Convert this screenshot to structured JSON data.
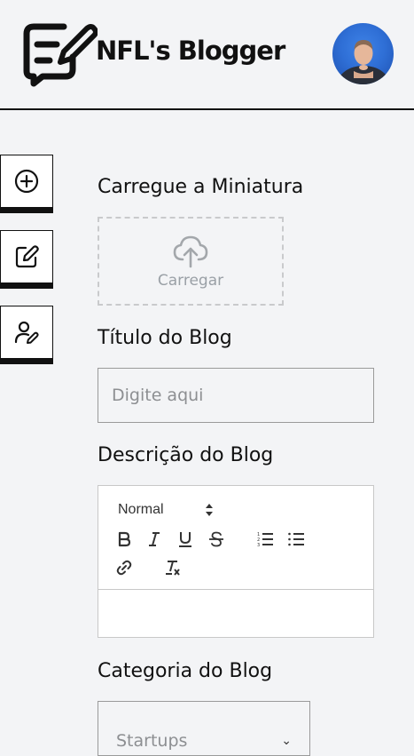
{
  "header": {
    "brand": "NFL's Blogger",
    "logo_icon": "edit-message-icon",
    "avatar_label": "user-avatar"
  },
  "sidebar": {
    "items": [
      {
        "icon": "plus-circle-icon",
        "name": "create"
      },
      {
        "icon": "edit-square-icon",
        "name": "edit"
      },
      {
        "icon": "user-edit-icon",
        "name": "profile"
      }
    ]
  },
  "form": {
    "thumbnail_label": "Carregue a Miniatura",
    "upload_text": "Carregar",
    "title_label": "Título do Blog",
    "title_placeholder": "Digite aqui",
    "title_value": "",
    "description_label": "Descrição do Blog",
    "editor": {
      "header_value": "Normal",
      "tools": [
        "bold",
        "italic",
        "underline",
        "strike",
        "ordered-list",
        "bullet-list",
        "link",
        "clean"
      ]
    },
    "category_label": "Categoria do Blog",
    "category_value": "Startups"
  },
  "colors": {
    "background": "#f3f4f6",
    "ink": "#111111",
    "muted": "#8d8f92",
    "avatar_blue": "#2f6fd6"
  }
}
